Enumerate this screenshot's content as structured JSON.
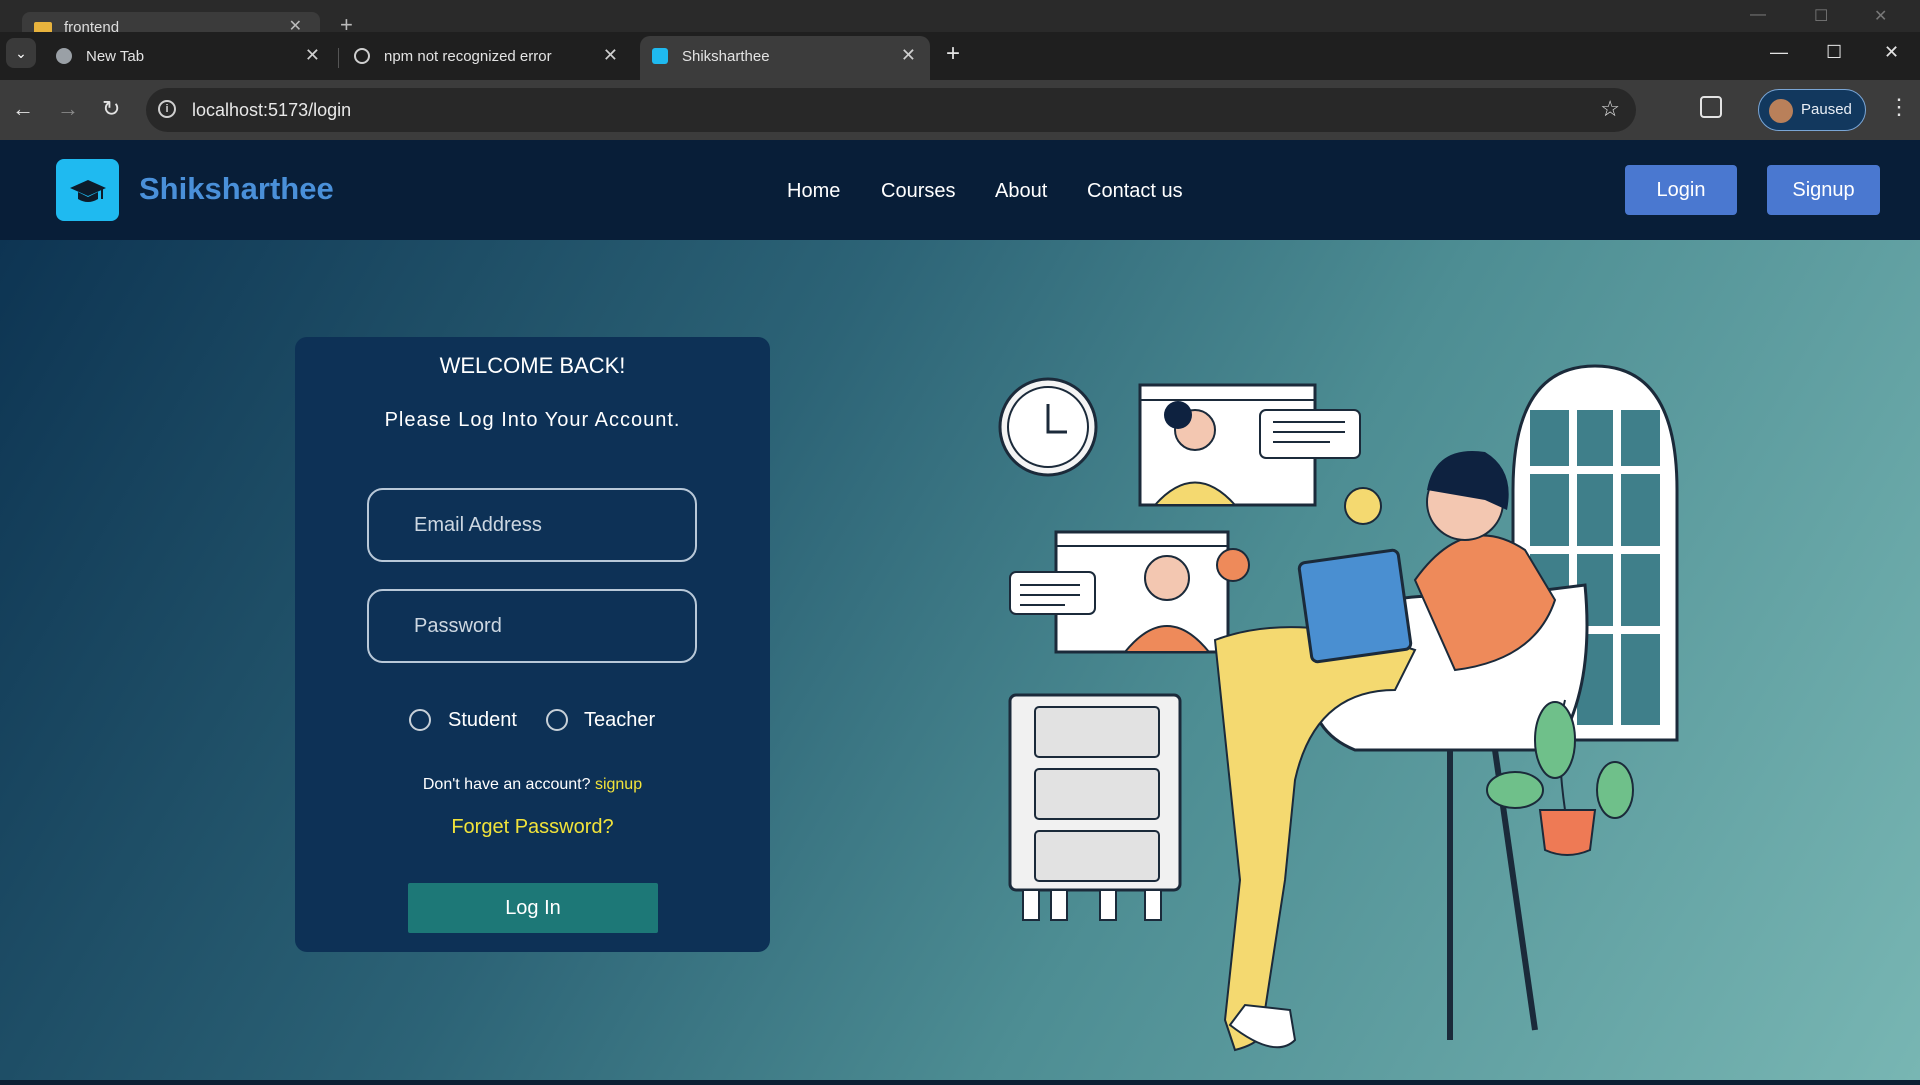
{
  "browser": {
    "background_window": {
      "tab_label": "frontend"
    },
    "tabs": [
      {
        "title": "New Tab",
        "icon": "globe-icon",
        "active": false
      },
      {
        "title": "npm not recognized error",
        "icon": "openai-icon",
        "active": false
      },
      {
        "title": "Shiksharthee",
        "icon": "graduation-cap-icon",
        "active": true
      }
    ],
    "address_bar": {
      "url": "localhost:5173/login"
    },
    "profile": {
      "label": "Paused"
    }
  },
  "site": {
    "brand": "Shiksharthee",
    "nav": [
      "Home",
      "Courses",
      "About",
      "Contact us"
    ],
    "buttons": {
      "login": "Login",
      "signup": "Signup"
    }
  },
  "login_card": {
    "welcome": "WELCOME BACK!",
    "subtitle": "Please Log Into Your Account.",
    "email_placeholder": "Email Address",
    "password_placeholder": "Password",
    "roles": [
      "Student",
      "Teacher"
    ],
    "signup_prompt": "Don't have an account?",
    "signup_link": "signup",
    "forgot": "Forget Password?",
    "submit": "Log In"
  },
  "colors": {
    "navbar": "#081e38",
    "brand_text": "#4a90d9",
    "nav_buttons": "#4a78d0",
    "card": "#0d3156",
    "accent_link": "#f2e33a",
    "submit_button": "#1d7877"
  }
}
